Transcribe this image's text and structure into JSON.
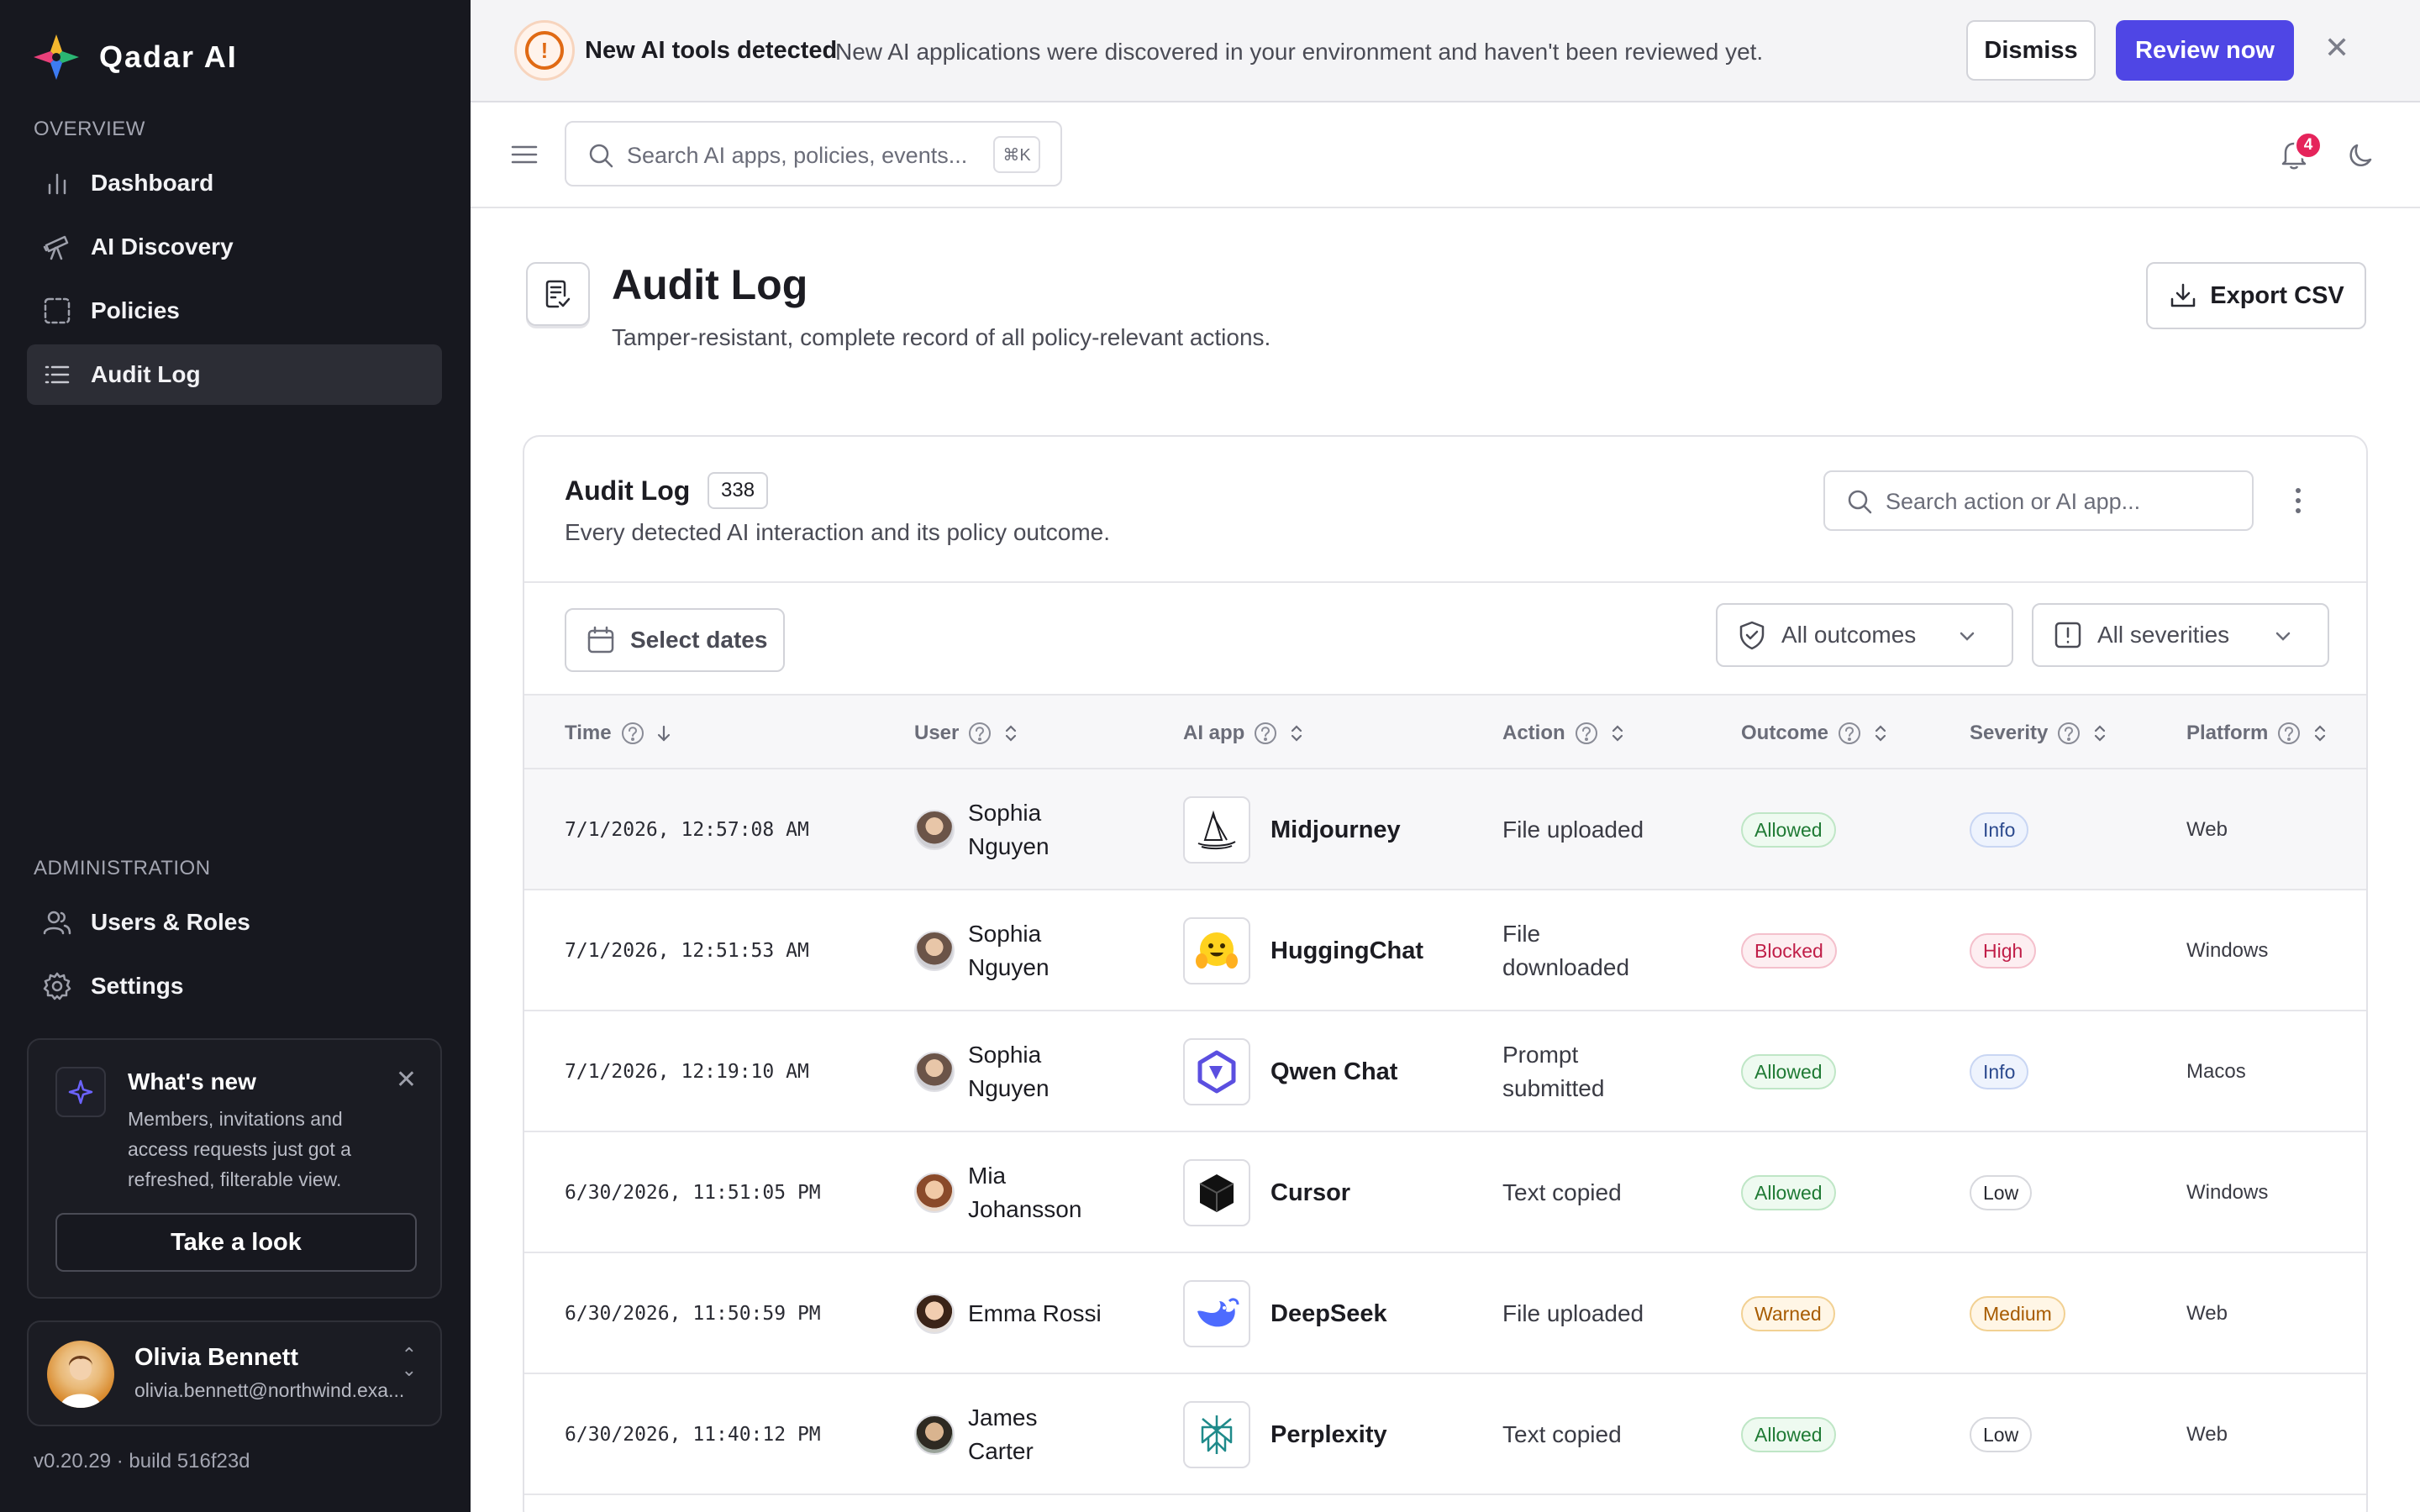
{
  "app": {
    "brand_name": "Qadar AI",
    "version": "v0.20.29 · build 516f23d"
  },
  "sidebar": {
    "overview_label": "OVERVIEW",
    "admin_label": "ADMINISTRATION",
    "overview_items": [
      {
        "label": "Dashboard",
        "icon": "bar-chart-icon"
      },
      {
        "label": "AI Discovery",
        "icon": "telescope-icon"
      },
      {
        "label": "Policies",
        "icon": "policy-frame-icon"
      },
      {
        "label": "Audit Log",
        "icon": "list-icon",
        "active": true
      }
    ],
    "admin_items": [
      {
        "label": "Users & Roles",
        "icon": "users-icon"
      },
      {
        "label": "Settings",
        "icon": "gear-icon"
      }
    ],
    "whats_new": {
      "title": "What's new",
      "text": "Members, invitations and access requests just got a refreshed, filterable view.",
      "button": "Take a look"
    },
    "user": {
      "name": "Olivia Bennett",
      "email": "olivia.bennett@northwind.exa..."
    }
  },
  "banner": {
    "title": "New AI tools detected",
    "text": "New AI applications were discovered in your environment and haven't been reviewed yet.",
    "dismiss": "Dismiss",
    "review": "Review now"
  },
  "topbar": {
    "search_placeholder": "Search AI apps, policies, events...",
    "shortcut": "⌘K",
    "notification_count": "4"
  },
  "page": {
    "title": "Audit Log",
    "subtitle": "Tamper-resistant, complete record of all policy-relevant actions.",
    "export_label": "Export CSV"
  },
  "card": {
    "title": "Audit Log",
    "count": "338",
    "subtitle": "Every detected AI interaction and its policy outcome.",
    "search_placeholder": "Search action or AI app...",
    "date_filter": "Select dates",
    "outcome_filter": "All outcomes",
    "severity_filter": "All severities"
  },
  "table": {
    "columns": [
      "Time",
      "User",
      "AI app",
      "Action",
      "Outcome",
      "Severity",
      "Platform"
    ],
    "rows": [
      {
        "time": "7/1/2026, 12:57:08 AM",
        "user": "Sophia Nguyen",
        "app": "Midjourney",
        "action": "File uploaded",
        "outcome": "Allowed",
        "severity": "Info",
        "platform": "Web"
      },
      {
        "time": "7/1/2026, 12:51:53 AM",
        "user": "Sophia Nguyen",
        "app": "HuggingChat",
        "action": "File downloaded",
        "outcome": "Blocked",
        "severity": "High",
        "platform": "Windows"
      },
      {
        "time": "7/1/2026, 12:19:10 AM",
        "user": "Sophia Nguyen",
        "app": "Qwen Chat",
        "action": "Prompt submitted",
        "outcome": "Allowed",
        "severity": "Info",
        "platform": "Macos"
      },
      {
        "time": "6/30/2026, 11:51:05 PM",
        "user": "Mia Johansson",
        "app": "Cursor",
        "action": "Text copied",
        "outcome": "Allowed",
        "severity": "Low",
        "platform": "Windows"
      },
      {
        "time": "6/30/2026, 11:50:59 PM",
        "user": "Emma Rossi",
        "app": "DeepSeek",
        "action": "File uploaded",
        "outcome": "Warned",
        "severity": "Medium",
        "platform": "Web"
      },
      {
        "time": "6/30/2026, 11:40:12 PM",
        "user": "James Carter",
        "app": "Perplexity",
        "action": "Text copied",
        "outcome": "Allowed",
        "severity": "Low",
        "platform": "Web"
      }
    ]
  },
  "colors": {
    "accent": "#4f46e5",
    "sidebar_bg": "#17181f",
    "allowed": "#1f7a34",
    "blocked": "#c01e48",
    "warned": "#a75b00"
  }
}
